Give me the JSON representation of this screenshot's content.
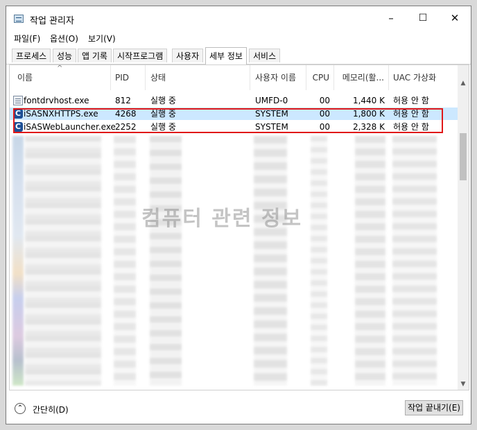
{
  "window": {
    "title": "작업 관리자",
    "minimize": "–",
    "maximize": "☐",
    "close": "✕"
  },
  "menu": [
    "파일(F)",
    "옵션(O)",
    "보기(V)"
  ],
  "tabs": [
    "프로세스",
    "성능",
    "앱 기록",
    "시작프로그램",
    "사용자",
    "세부 정보",
    "서비스"
  ],
  "active_tab": "세부 정보",
  "columns": [
    "이름",
    "PID",
    "상태",
    "사용자 이름",
    "CPU",
    "메모리(활...",
    "UAC 가상화"
  ],
  "rows": [
    {
      "icon": "generic-process-icon",
      "name": "fontdrvhost.exe",
      "pid": "812",
      "status": "실행 중",
      "user": "UMFD-0",
      "cpu": "00",
      "memory": "1,440 K",
      "uac": "허용 안 함",
      "selected": false
    },
    {
      "icon": "isas-app-icon",
      "name": "iSASNXHTTPS.exe",
      "pid": "4268",
      "status": "실행 중",
      "user": "SYSTEM",
      "cpu": "00",
      "memory": "1,800 K",
      "uac": "허용 안 함",
      "selected": true
    },
    {
      "icon": "isas-app-icon",
      "name": "iSASWebLauncher.exe",
      "pid": "2252",
      "status": "실행 중",
      "user": "SYSTEM",
      "cpu": "00",
      "memory": "2,328 K",
      "uac": "허용 안 함",
      "selected": false
    }
  ],
  "watermark": "컴퓨터 관련 정보",
  "footer": {
    "fewer_details": "간단히(D)",
    "end_task": "작업 끝내기(E)"
  },
  "colors": {
    "selected_row": "#cce8ff",
    "highlight_border": "#e01818",
    "isas_icon": "#1d4f95"
  }
}
